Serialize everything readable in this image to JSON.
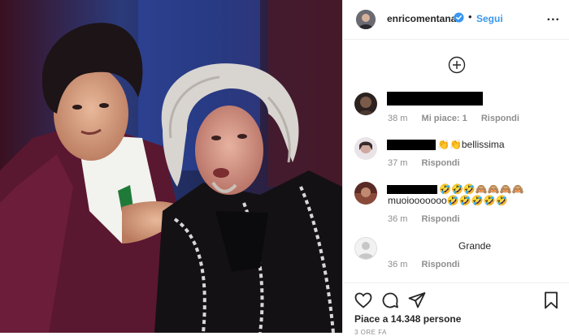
{
  "header": {
    "username": "enricomentana",
    "separator": "•",
    "follow_label": "Segui",
    "more_label": "..."
  },
  "comments": [
    {
      "text": "",
      "time": "38 m",
      "likes": "Mi piace: 1",
      "reply": "Rispondi"
    },
    {
      "text": "👏👏bellissima",
      "time": "37 m",
      "reply": "Rispondi"
    },
    {
      "text": "🤣🤣🤣🙈🙈🙈🙈",
      "text2": "muoiooooooo🤣🤣🤣🤣🤣",
      "time": "36 m",
      "reply": "Rispondi"
    },
    {
      "text": "Grande",
      "time": "36 m",
      "reply": "Rispondi"
    }
  ],
  "footer": {
    "likes_text": "Piace a 14.348 persone",
    "timestamp": "3 ORE FA"
  },
  "colors": {
    "link": "#3897f0",
    "muted": "#8e8e8e",
    "text": "#262626",
    "border": "#efefef"
  },
  "icons": [
    "heart-icon",
    "comment-icon",
    "share-icon",
    "bookmark-icon",
    "add-comment-icon",
    "verified-badge-icon"
  ]
}
